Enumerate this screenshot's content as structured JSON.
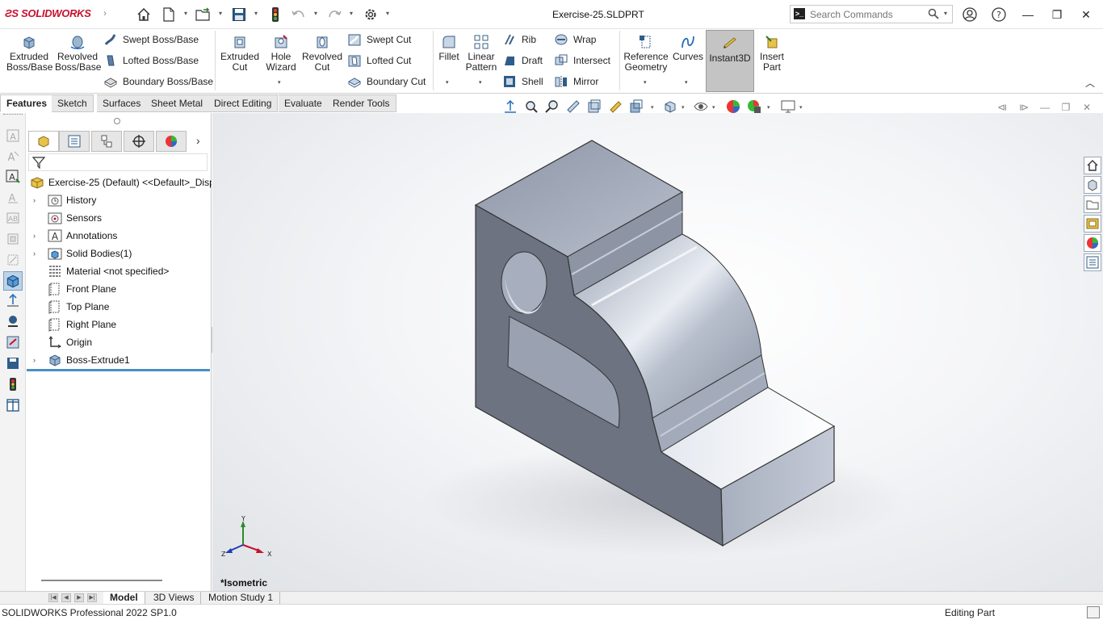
{
  "app": {
    "logo_text": "SOLIDWORKS",
    "document_title": "Exercise-25.SLDPRT"
  },
  "search": {
    "placeholder": "Search Commands"
  },
  "ribbon": {
    "extruded_boss": "Extruded\nBoss/Base",
    "revolved_boss": "Revolved\nBoss/Base",
    "swept_boss": "Swept Boss/Base",
    "lofted_boss": "Lofted Boss/Base",
    "boundary_boss": "Boundary Boss/Base",
    "extruded_cut": "Extruded\nCut",
    "hole_wizard": "Hole\nWizard",
    "revolved_cut": "Revolved\nCut",
    "swept_cut": "Swept Cut",
    "lofted_cut": "Lofted Cut",
    "boundary_cut": "Boundary Cut",
    "fillet": "Fillet",
    "linear_pattern": "Linear\nPattern",
    "rib": "Rib",
    "draft": "Draft",
    "shell": "Shell",
    "wrap": "Wrap",
    "intersect": "Intersect",
    "mirror": "Mirror",
    "reference_geometry": "Reference\nGeometry",
    "curves": "Curves",
    "instant3d": "Instant3D",
    "insert_part": "Insert\nPart"
  },
  "tabs": [
    "Features",
    "Sketch",
    "Surfaces",
    "Sheet Metal",
    "Direct Editing",
    "Evaluate",
    "Render Tools"
  ],
  "tree": {
    "root": "Exercise-25 (Default) <<Default>_Disp",
    "items": [
      "History",
      "Sensors",
      "Annotations",
      "Solid Bodies(1)",
      "Material <not specified>",
      "Front Plane",
      "Top Plane",
      "Right Plane",
      "Origin",
      "Boss-Extrude1"
    ]
  },
  "viewport": {
    "view_label": "*Isometric",
    "triad": {
      "y": "Y",
      "x": "X",
      "z": "Z"
    }
  },
  "bottom_tabs": [
    "Model",
    "3D Views",
    "Motion Study 1"
  ],
  "status": {
    "left": "SOLIDWORKS Professional 2022 SP1.0",
    "right": "Editing Part"
  },
  "colors": {
    "brand": "#c8102e",
    "active_tool": "#c4c4c4",
    "rollback_bar": "#4a8fc2"
  }
}
